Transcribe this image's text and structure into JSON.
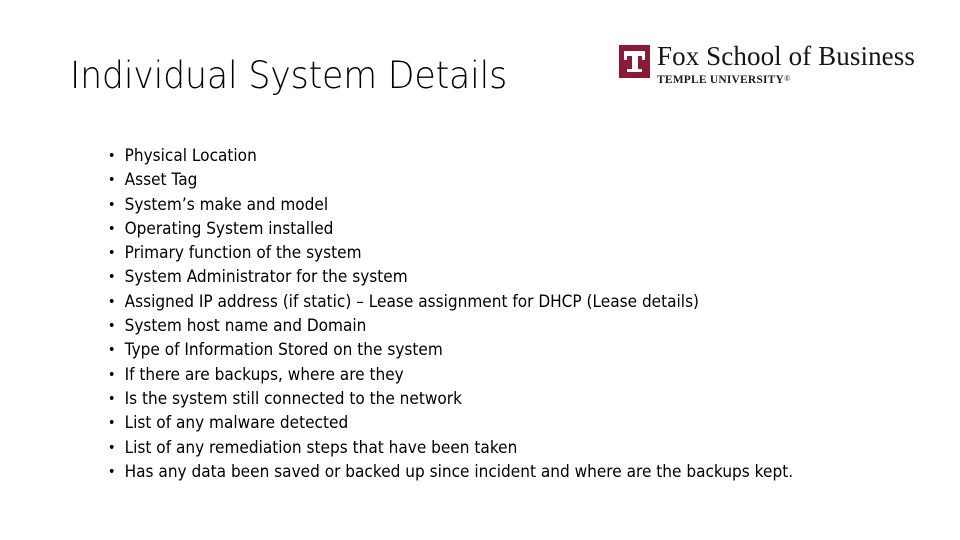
{
  "slide": {
    "title": "Individual System Details",
    "background_color": "#ffffff",
    "text_color": "#000000"
  },
  "logo": {
    "mark_letter": "T",
    "mark_color": "#8C1A36",
    "mark_letter_color": "#ffffff",
    "title": "Fox School of Business",
    "subtitle": "TEMPLE UNIVERSITY",
    "registered_mark": "®"
  },
  "content": {
    "bullets": [
      "Physical Location",
      "Asset Tag",
      "System’s make and model",
      "Operating System installed",
      "Primary function of the system",
      "System Administrator for the system",
      "Assigned IP address (if static) – Lease assignment for DHCP (Lease details)",
      "System host name and Domain",
      "Type of Information Stored on the system",
      "If there are backups, where are they",
      "Is the system still connected to the network",
      "List of any malware detected",
      "List of any remediation steps that have been taken",
      "Has any data been saved or backed up since incident and where are the backups kept."
    ]
  }
}
